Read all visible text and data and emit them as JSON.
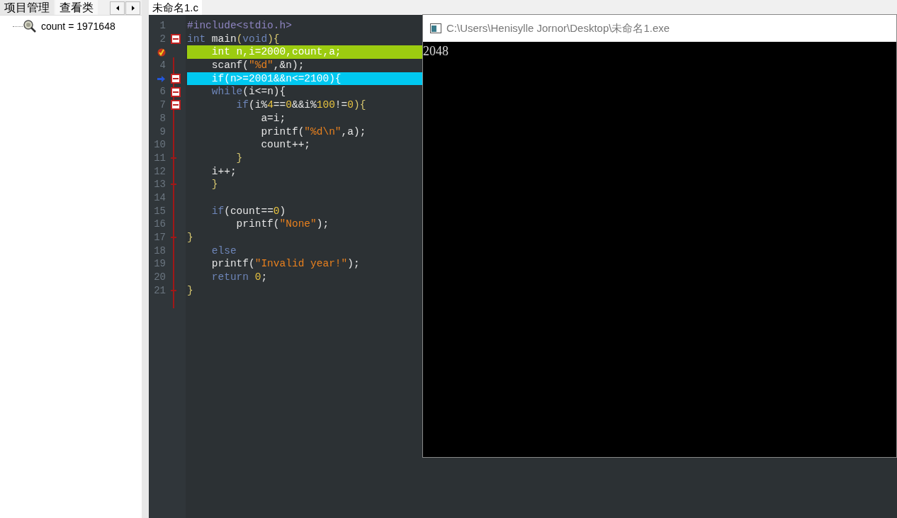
{
  "left_tabs": [
    {
      "label": "项目管理",
      "selected": false
    },
    {
      "label": "查看类",
      "selected": true
    }
  ],
  "watch_items": [
    {
      "label": "count = 1971648"
    }
  ],
  "editor_tabs": [
    {
      "label": "未命名1.c",
      "selected": true
    }
  ],
  "code_lines": [
    {
      "number": "1",
      "tokens": [
        {
          "text": "#include<stdio.h>",
          "kind": "preproc"
        }
      ]
    },
    {
      "number": "2",
      "fold_start": true,
      "tokens": [
        {
          "text": "int",
          "kind": "keyword"
        },
        {
          "text": " main",
          "kind": "plain"
        },
        {
          "text": "(",
          "kind": "punct"
        },
        {
          "text": "void",
          "kind": "keyword"
        },
        {
          "text": "){",
          "kind": "punct"
        }
      ]
    },
    {
      "breakpoint": true,
      "tokens": [
        {
          "text": "    int n,i=2000,count,a;",
          "kind": "plain"
        }
      ]
    },
    {
      "number": "4",
      "tokens": [
        {
          "text": "    scanf(",
          "kind": "plain"
        },
        {
          "text": "\"%d\"",
          "kind": "string"
        },
        {
          "text": ",&n);",
          "kind": "plain"
        }
      ]
    },
    {
      "current_line": true,
      "fold_start": true,
      "tokens": [
        {
          "text": "    if(n>=2001&&n<=2100){",
          "kind": "plain"
        }
      ]
    },
    {
      "number": "6",
      "fold_start": true,
      "tokens": [
        {
          "text": "    while",
          "kind": "keyword"
        },
        {
          "text": "(i<=n){",
          "kind": "plain"
        }
      ]
    },
    {
      "number": "7",
      "fold_start": true,
      "tokens": [
        {
          "text": "        if",
          "kind": "keyword"
        },
        {
          "text": "(i%",
          "kind": "plain"
        },
        {
          "text": "4",
          "kind": "number"
        },
        {
          "text": "==",
          "kind": "plain"
        },
        {
          "text": "0",
          "kind": "number"
        },
        {
          "text": "&&i%",
          "kind": "plain"
        },
        {
          "text": "100",
          "kind": "number"
        },
        {
          "text": "!=",
          "kind": "plain"
        },
        {
          "text": "0",
          "kind": "number"
        },
        {
          "text": "){",
          "kind": "punct"
        }
      ]
    },
    {
      "number": "8",
      "tokens": [
        {
          "text": "            a=i;",
          "kind": "plain"
        }
      ]
    },
    {
      "number": "9",
      "tokens": [
        {
          "text": "            printf(",
          "kind": "plain"
        },
        {
          "text": "\"%d\\n\"",
          "kind": "string"
        },
        {
          "text": ",a);",
          "kind": "plain"
        }
      ]
    },
    {
      "number": "10",
      "tokens": [
        {
          "text": "            count++;",
          "kind": "plain"
        }
      ]
    },
    {
      "number": "11",
      "fold_end": true,
      "tokens": [
        {
          "text": "        }",
          "kind": "punct"
        }
      ]
    },
    {
      "number": "12",
      "tokens": [
        {
          "text": "    i++;",
          "kind": "plain"
        }
      ]
    },
    {
      "number": "13",
      "fold_end": true,
      "tokens": [
        {
          "text": "    }",
          "kind": "punct"
        }
      ]
    },
    {
      "number": "14"
    },
    {
      "number": "15",
      "tokens": [
        {
          "text": "    if",
          "kind": "keyword"
        },
        {
          "text": "(count==",
          "kind": "plain"
        },
        {
          "text": "0",
          "kind": "number"
        },
        {
          "text": ")",
          "kind": "plain"
        }
      ]
    },
    {
      "number": "16",
      "tokens": [
        {
          "text": "        printf(",
          "kind": "plain"
        },
        {
          "text": "\"None\"",
          "kind": "string"
        },
        {
          "text": ");",
          "kind": "plain"
        }
      ]
    },
    {
      "number": "17",
      "fold_end": true,
      "tokens": [
        {
          "text": "}",
          "kind": "punct"
        }
      ]
    },
    {
      "number": "18",
      "tokens": [
        {
          "text": "    else",
          "kind": "keyword"
        }
      ]
    },
    {
      "number": "19",
      "tokens": [
        {
          "text": "    printf(",
          "kind": "plain"
        },
        {
          "text": "\"Invalid year!\"",
          "kind": "string"
        },
        {
          "text": ");",
          "kind": "plain"
        }
      ]
    },
    {
      "number": "20",
      "tokens": [
        {
          "text": "    return",
          "kind": "keyword"
        },
        {
          "text": " 0",
          "kind": "number"
        },
        {
          "text": ";",
          "kind": "plain"
        }
      ]
    },
    {
      "number": "21",
      "fold_end": true,
      "tokens": [
        {
          "text": "}",
          "kind": "punct"
        }
      ]
    }
  ],
  "console": {
    "title": "C:\\Users\\Henisylle Jornor\\Desktop\\未命名1.exe",
    "output": "2048"
  }
}
